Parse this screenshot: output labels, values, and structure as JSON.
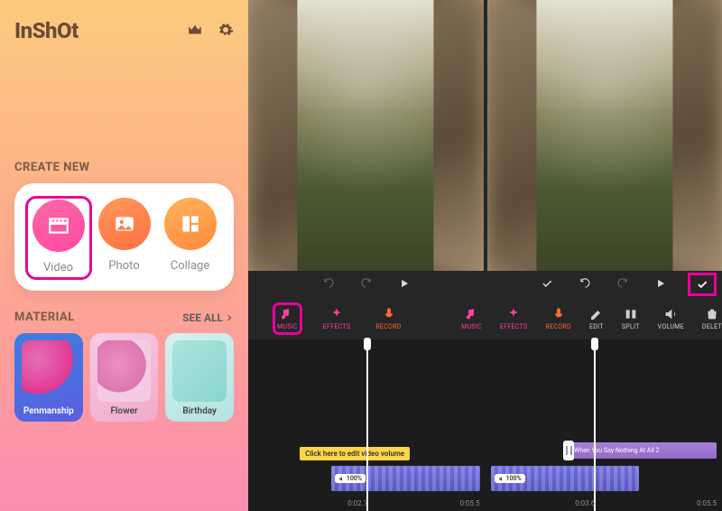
{
  "sidebar": {
    "logo": "InShOt",
    "create_label": "CREATE NEW",
    "items": {
      "video": "Video",
      "photo": "Photo",
      "collage": "Collage"
    },
    "material_label": "MATERIAL",
    "see_all": "SEE ALL",
    "materials": {
      "penmanship": "Penmanship",
      "flower": "Flower",
      "birthday": "Birthday"
    }
  },
  "toolbar": {
    "music": "MUSIC",
    "effects": "EFFECTS",
    "record": "RECORD",
    "edit": "EDIT",
    "split": "SPLIT",
    "volume": "VOLUME",
    "delete": "DELET"
  },
  "timeline": {
    "hint": "Click here to edit video volume",
    "audio_title": "When You Say Nothing At All 2",
    "vol_badge": "100%",
    "left": {
      "t1": "0:02.7",
      "t2": "0:05.5"
    },
    "right": {
      "t1": "0:03.6",
      "t2": "0:05.5"
    }
  }
}
